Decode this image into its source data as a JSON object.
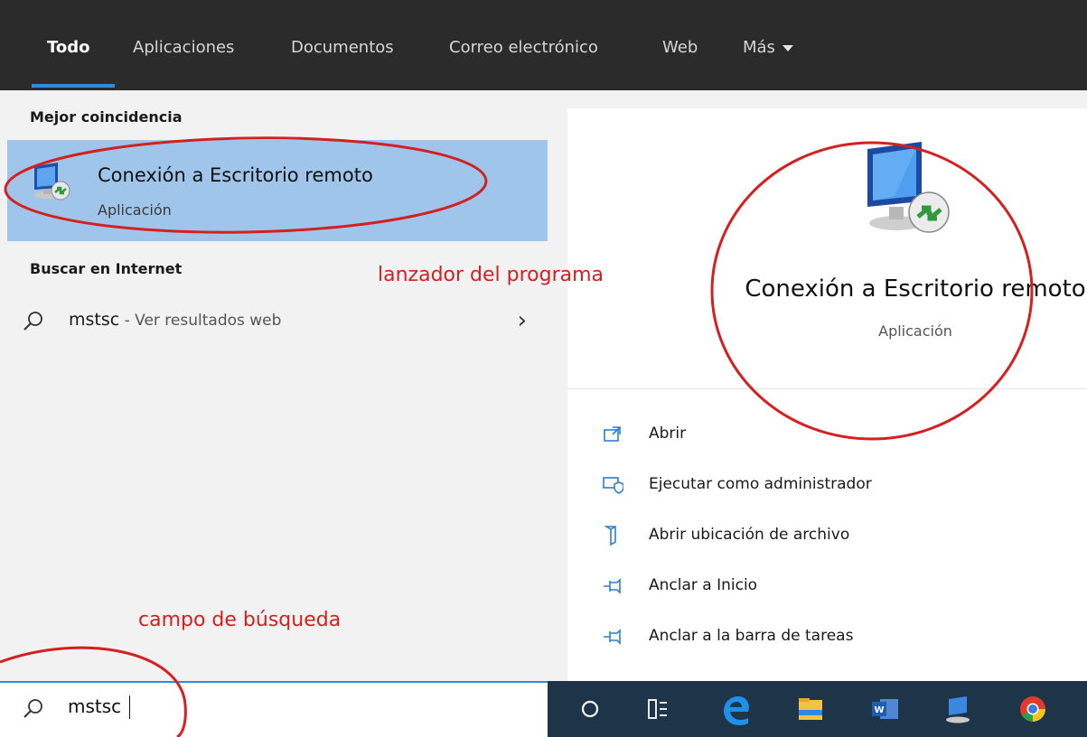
{
  "tabs": [
    {
      "label": "Todo",
      "active": true
    },
    {
      "label": "Aplicaciones"
    },
    {
      "label": "Documentos"
    },
    {
      "label": "Correo electrónico"
    },
    {
      "label": "Web"
    },
    {
      "label": "Más"
    }
  ],
  "left": {
    "best_match_header": "Mejor coincidencia",
    "best_match": {
      "title": "Conexión a Escritorio remoto",
      "subtitle": "Aplicación",
      "icon": "remote-desktop-icon"
    },
    "web_header": "Buscar en Internet",
    "web_result": {
      "query": "mstsc",
      "suffix": " - Ver resultados web"
    }
  },
  "annotations": {
    "launcher": "lanzador del programa",
    "search_field": "campo de búsqueda"
  },
  "preview": {
    "title": "Conexión a Escritorio remoto",
    "subtitle": "Aplicación"
  },
  "actions": [
    {
      "label": "Abrir",
      "icon": "open-icon"
    },
    {
      "label": "Ejecutar como administrador",
      "icon": "shield-icon"
    },
    {
      "label": "Abrir ubicación de archivo",
      "icon": "folder-location-icon"
    },
    {
      "label": "Anclar a Inicio",
      "icon": "pin-icon"
    },
    {
      "label": "Anclar a la barra de tareas",
      "icon": "pin-icon"
    }
  ],
  "search": {
    "value": "mstsc"
  },
  "colors": {
    "accent": "#2d8ce0",
    "annotation": "#d32020",
    "selection": "#9fc6ea",
    "taskbar": "#1e3449"
  },
  "taskbar_items": [
    "cortana-icon",
    "task-view-icon",
    "edge-icon",
    "file-explorer-icon",
    "word-icon",
    "remote-desktop-icon",
    "chrome-icon"
  ]
}
